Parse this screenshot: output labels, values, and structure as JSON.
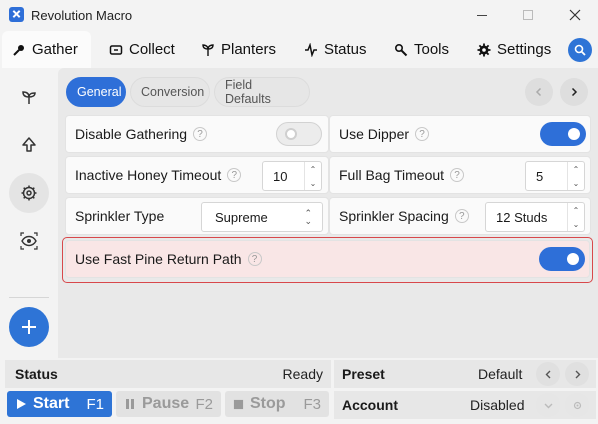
{
  "window": {
    "title": "Revolution Macro"
  },
  "tabs": [
    {
      "label": "Gather",
      "icon": "gather-icon",
      "active": true
    },
    {
      "label": "Collect",
      "icon": "collect-icon"
    },
    {
      "label": "Planters",
      "icon": "planter-icon"
    },
    {
      "label": "Status",
      "icon": "status-icon"
    },
    {
      "label": "Tools",
      "icon": "tools-icon"
    },
    {
      "label": "Settings",
      "icon": "gear-icon"
    }
  ],
  "sidebar": {
    "items": [
      "sprout-icon",
      "upload-icon",
      "gear-icon",
      "eye-icon"
    ],
    "active_index": 2
  },
  "subtabs": [
    {
      "label": "General",
      "active": true
    },
    {
      "label": "Conversion"
    },
    {
      "label": "Field Defaults"
    }
  ],
  "settings": {
    "disable_gathering": {
      "label": "Disable Gathering",
      "help": "?",
      "value": false
    },
    "use_dipper": {
      "label": "Use Dipper",
      "help": "?",
      "value": true
    },
    "inactive_honey_timeout": {
      "label": "Inactive Honey Timeout",
      "help": "?",
      "value": "10"
    },
    "full_bag_timeout": {
      "label": "Full Bag Timeout",
      "help": "?",
      "value": "5"
    },
    "sprinkler_type": {
      "label": "Sprinkler Type",
      "value": "Supreme"
    },
    "sprinkler_spacing": {
      "label": "Sprinkler Spacing",
      "help": "?",
      "value": "12 Studs"
    },
    "use_fast_pine_return_path": {
      "label": "Use Fast Pine Return Path",
      "help": "?",
      "value": true
    }
  },
  "bottom": {
    "status_label": "Status",
    "status_value": "Ready",
    "preset_label": "Preset",
    "preset_value": "Default",
    "account_label": "Account",
    "account_value": "Disabled",
    "start": {
      "label": "Start",
      "key": "F1"
    },
    "pause": {
      "label": "Pause",
      "key": "F2"
    },
    "stop": {
      "label": "Stop",
      "key": "F3"
    }
  },
  "colors": {
    "accent": "#2e6fd8",
    "highlight_border": "#d8484b",
    "highlight_bg": "#f9e6e6"
  }
}
